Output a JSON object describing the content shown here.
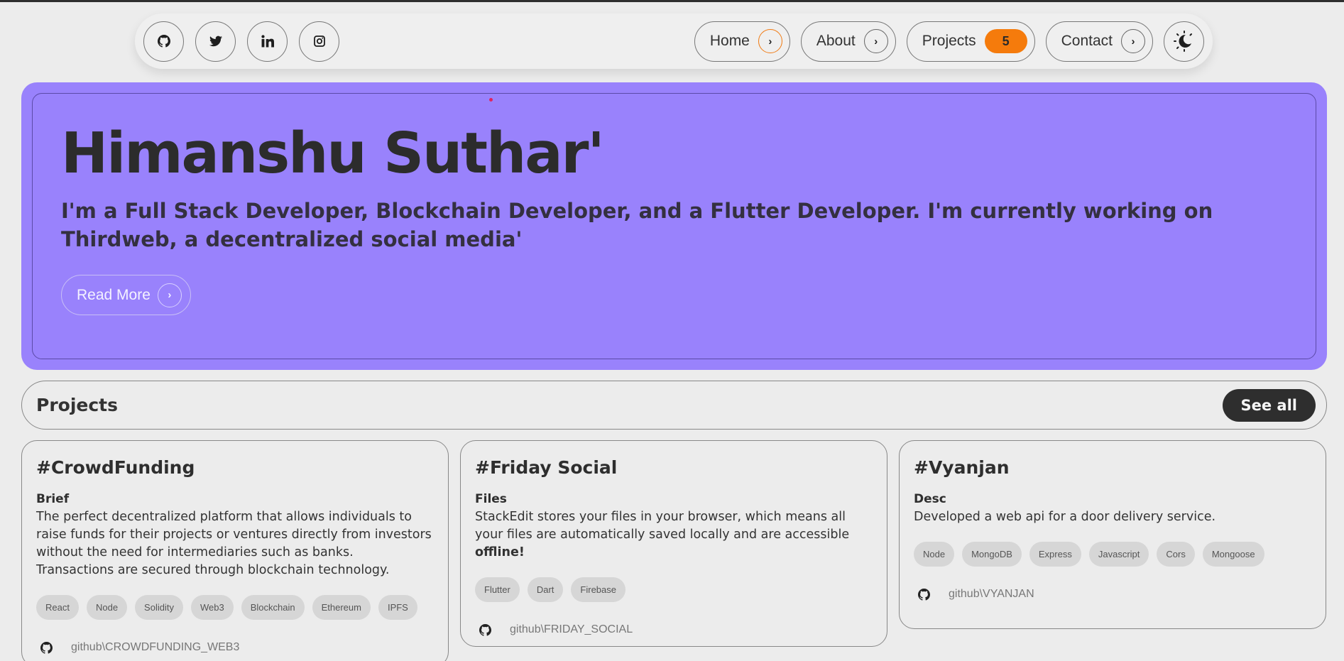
{
  "nav": {
    "socials": [
      {
        "icon": "github-icon"
      },
      {
        "icon": "twitter-icon"
      },
      {
        "icon": "linkedin-icon"
      },
      {
        "icon": "instagram-icon"
      }
    ],
    "links": [
      {
        "label": "Home"
      },
      {
        "label": "About"
      },
      {
        "label": "Projects",
        "badge": "5"
      },
      {
        "label": "Contact"
      }
    ],
    "theme_icon": "dark-mode-icon",
    "accent": "#f57b0c"
  },
  "hero": {
    "title": "Himanshu Suthar'",
    "text": "I'm a Full Stack Developer, Blockchain Developer, and a Flutter Developer. I'm currently working on Thirdweb, a decentralized social media'",
    "button": "Read More",
    "background": "#9982fc"
  },
  "projects": {
    "heading": "Projects",
    "see_all": "See all",
    "cards": [
      {
        "title": "#CrowdFunding",
        "subhead": "Brief",
        "desc": "The perfect decentralized platform that allows individuals to raise funds for their projects or ventures directly from investors without the need for intermediaries such as banks. Transactions are secured through blockchain technology.",
        "tags": [
          "React",
          "Node",
          "Solidity",
          "Web3",
          "Blockchain",
          "Ethereum",
          "IPFS"
        ],
        "repo": "github\\CROWDFUNDING_WEB3"
      },
      {
        "title": "#Friday Social",
        "subhead": "Files",
        "desc": "StackEdit stores your files in your browser, which means all your files are automatically saved locally and are accessible",
        "desc_bold": "offline!",
        "tags": [
          "Flutter",
          "Dart",
          "Firebase"
        ],
        "repo": "github\\FRIDAY_SOCIAL"
      },
      {
        "title": "#Vyanjan",
        "subhead": "Desc",
        "desc": "Developed a web api for a door delivery service.",
        "tags": [
          "Node",
          "MongoDB",
          "Express",
          "Javascript",
          "Cors",
          "Mongoose"
        ],
        "repo": "github\\VYANJAN"
      }
    ]
  }
}
